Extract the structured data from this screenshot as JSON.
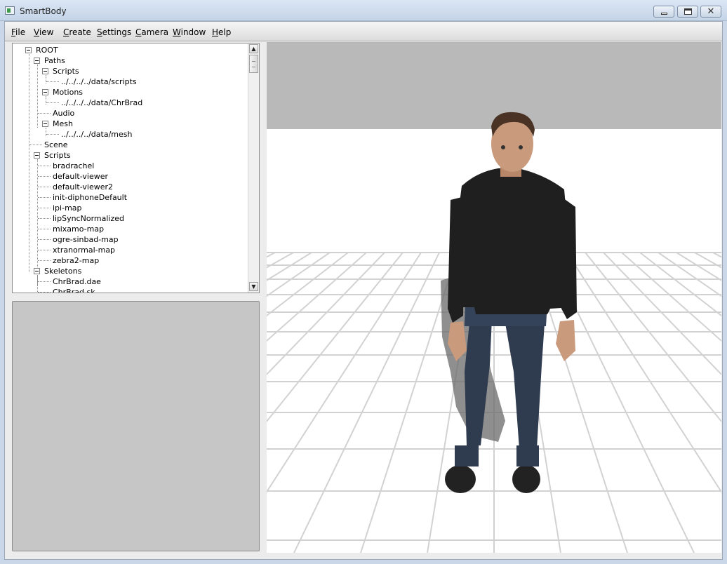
{
  "window": {
    "title": "SmartBody",
    "min_label": "",
    "max_label": "",
    "close_label": "✕"
  },
  "menu": {
    "items": [
      {
        "accel": "F",
        "rest": "ile"
      },
      {
        "accel": "V",
        "rest": "iew"
      },
      {
        "accel": "C",
        "rest": "reate"
      },
      {
        "accel": "S",
        "rest": "ettings"
      },
      {
        "accel": "C",
        "rest": "amera"
      },
      {
        "accel": "W",
        "rest": "indow"
      },
      {
        "accel": "H",
        "rest": "elp"
      }
    ]
  },
  "tree": {
    "rows": [
      {
        "label": "ROOT"
      },
      {
        "label": "Paths"
      },
      {
        "label": "Scripts"
      },
      {
        "label": "../../../../data/scripts"
      },
      {
        "label": "Motions"
      },
      {
        "label": "../../../../data/ChrBrad"
      },
      {
        "label": "Audio"
      },
      {
        "label": "Mesh"
      },
      {
        "label": "../../../../data/mesh"
      },
      {
        "label": "Scene"
      },
      {
        "label": "Scripts"
      },
      {
        "label": "bradrachel"
      },
      {
        "label": "default-viewer"
      },
      {
        "label": "default-viewer2"
      },
      {
        "label": "init-diphoneDefault"
      },
      {
        "label": "ipi-map"
      },
      {
        "label": "lipSyncNormalized"
      },
      {
        "label": "mixamo-map"
      },
      {
        "label": "ogre-sinbad-map"
      },
      {
        "label": "xtranormal-map"
      },
      {
        "label": "zebra2-map"
      },
      {
        "label": "Skeletons"
      },
      {
        "label": "ChrBrad.dae"
      },
      {
        "label": "ChrBrad.sk"
      }
    ],
    "scroll_up": "▲",
    "scroll_down": "▼"
  },
  "colors": {
    "sky": "#b9b9b9",
    "floor": "#ffffff",
    "grid": "#d2d2d2",
    "shirt": "#1f1f1f",
    "jeans": "#2f3b4f",
    "skin": "#c99a7c"
  }
}
